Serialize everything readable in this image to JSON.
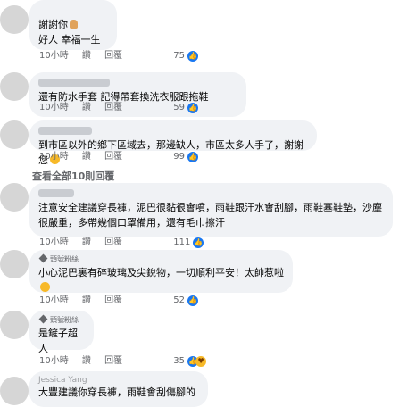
{
  "comments": [
    {
      "name": "",
      "lines": [
        "謝謝你",
        "好人 幸福一生"
      ],
      "time": "10小時",
      "reply_short": "讚",
      "reply": "回覆",
      "likes": "75"
    },
    {
      "name": "",
      "text": "還有防水手套 記得帶套換洗衣服跟拖鞋",
      "time": "10小時",
      "reply_short": "讚",
      "reply": "回覆",
      "likes": "59"
    },
    {
      "name": "",
      "text": "到市區以外的鄉下區域去，那邊缺人，市區太多人手了，謝謝您",
      "time": "10小時",
      "reply_short": "讚",
      "reply": "回覆",
      "likes": "99"
    },
    {
      "name": "",
      "text": "注意安全建議穿長褲，泥巴很黏很會噴，雨鞋跟汗水會刮腳，雨鞋塞鞋墊，沙塵很嚴重，多帶幾個口罩備用，還有毛巾擦汗",
      "time": "10小時",
      "reply_short": "讚",
      "reply": "回覆",
      "likes": "111"
    },
    {
      "badge": "頭號粉絲",
      "text": "小心泥巴裏有碎玻璃及尖銳物，一切順利平安！太帥惹啦",
      "time": "10小時",
      "reply_short": "讚",
      "reply": "回覆",
      "likes": "52"
    },
    {
      "badge": "頭號粉絲",
      "text": "是鏟子超人",
      "time": "10小時",
      "reply_short": "讚",
      "reply": "回覆",
      "likes": "35"
    },
    {
      "name": "Jessica Yang",
      "text": "大豐建議你穿長褲，雨鞋會刮傷腳的"
    }
  ],
  "view_all_replies": "查看全部10則回覆",
  "icons": {
    "like": "like-icon",
    "care": "care-icon",
    "emoji": "grinning-emoji-icon",
    "pray": "pray-emoji-icon",
    "badge": "top-fan-diamond-icon"
  },
  "colors": {
    "bubble": "#f0f2f5",
    "meta": "#65676b",
    "like_blue": "#1877f2"
  }
}
